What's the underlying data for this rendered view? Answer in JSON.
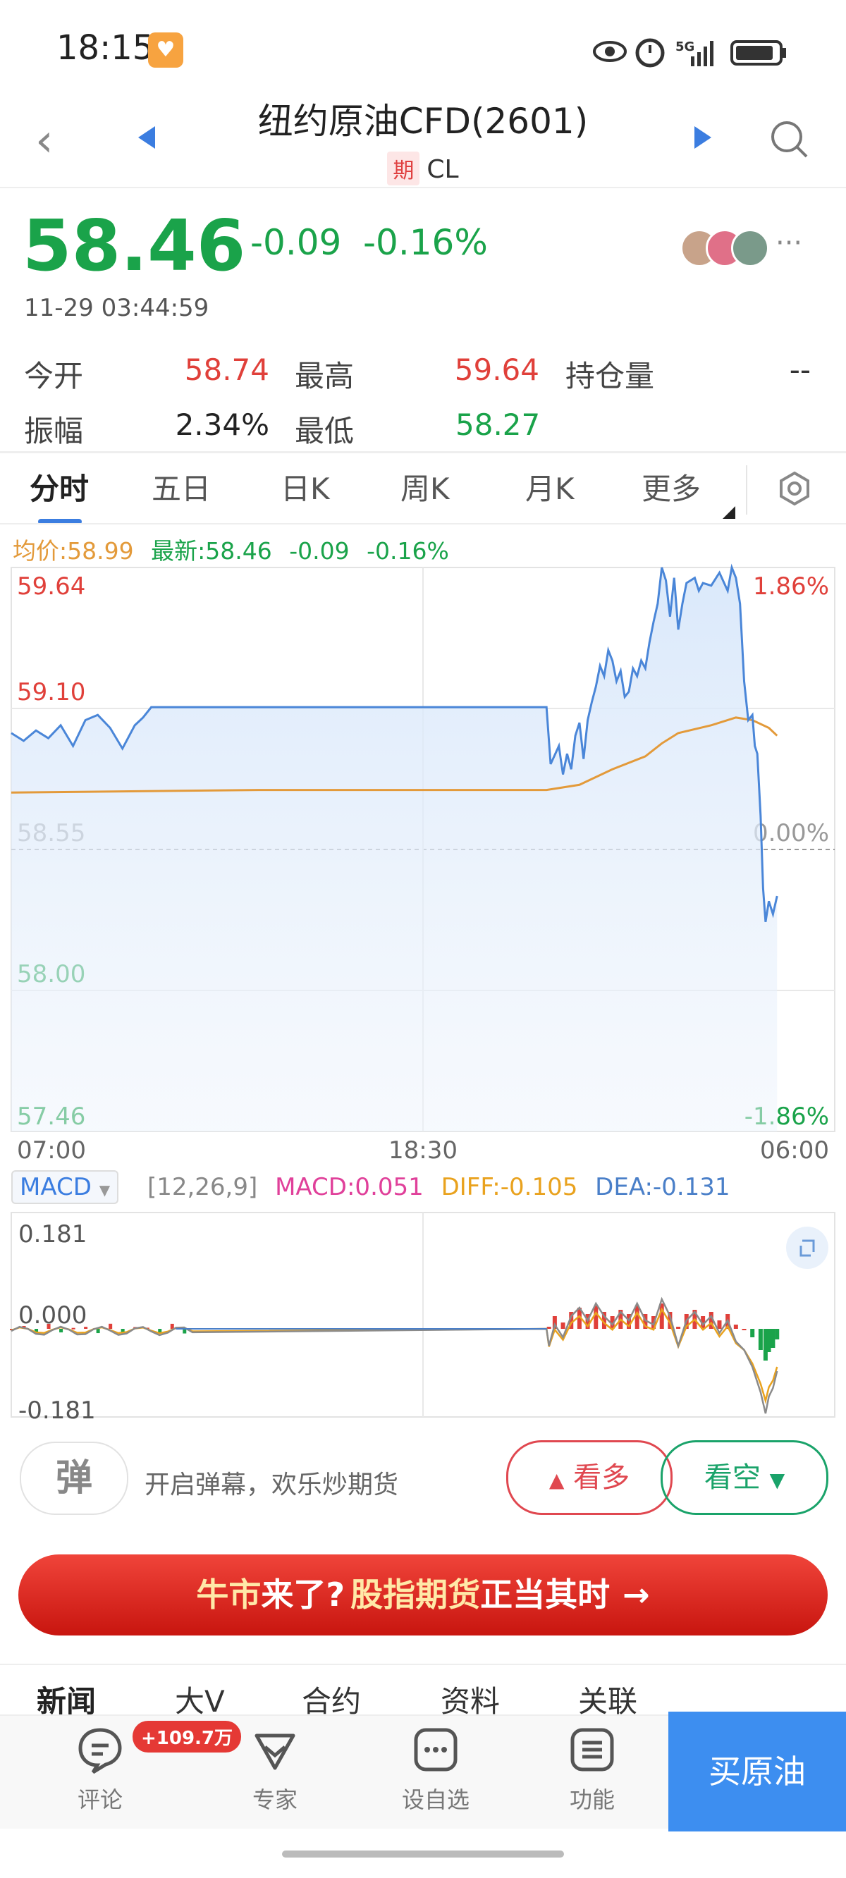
{
  "status_bar": {
    "time": "18:15",
    "network": "5G"
  },
  "header": {
    "title": "纽约原油CFD(2601)",
    "tag": "期",
    "code": "CL"
  },
  "quote": {
    "price": "58.46",
    "change": "-0.09",
    "change_pct": "-0.16%",
    "timestamp": "11-29 03:44:59",
    "stats": [
      {
        "label": "今开",
        "value": "58.74",
        "color": "#e0403a"
      },
      {
        "label": "最高",
        "value": "59.64",
        "color": "#e0403a"
      },
      {
        "label": "持仓量",
        "value": "--",
        "color": "#333333"
      },
      {
        "label": "振幅",
        "value": "2.34%",
        "color": "#222222"
      },
      {
        "label": "最低",
        "value": "58.27",
        "color": "#1aa34a"
      }
    ]
  },
  "tabs": [
    "分时",
    "五日",
    "日K",
    "周K",
    "月K",
    "更多"
  ],
  "chart_header": {
    "avg": "均价:58.99",
    "latest": "最新:58.46",
    "change": "-0.09",
    "change_pct": "-0.16%"
  },
  "chart_data": {
    "type": "line",
    "series": [],
    "x_ticks": [
      "07:00",
      "18:30",
      "06:00"
    ],
    "y_ticks_left": [
      "59.64",
      "59.10",
      "58.55",
      "58.00",
      "57.46"
    ],
    "y_ticks_right": [
      "1.86%",
      "",
      "0.00%",
      "",
      "-1.86%"
    ],
    "ylim": [
      57.46,
      59.64
    ],
    "baseline": 58.55,
    "price": [
      [
        0,
        59.0
      ],
      [
        1.5,
        58.97
      ],
      [
        3,
        59.01
      ],
      [
        4.5,
        58.98
      ],
      [
        6,
        59.03
      ],
      [
        7.5,
        58.95
      ],
      [
        9,
        59.05
      ],
      [
        10.5,
        59.07
      ],
      [
        12,
        59.02
      ],
      [
        13.5,
        58.94
      ],
      [
        15,
        59.03
      ],
      [
        16,
        59.06
      ],
      [
        17,
        59.1
      ],
      [
        30,
        59.1
      ],
      [
        45,
        59.1
      ],
      [
        60,
        59.1
      ],
      [
        65,
        59.1
      ],
      [
        65.5,
        58.88
      ],
      [
        66.5,
        58.95
      ],
      [
        67,
        58.84
      ],
      [
        67.5,
        58.92
      ],
      [
        68,
        58.86
      ],
      [
        68.5,
        58.99
      ],
      [
        69,
        59.04
      ],
      [
        69.5,
        58.9
      ],
      [
        70,
        59.05
      ],
      [
        70.5,
        59.12
      ],
      [
        71,
        59.18
      ],
      [
        71.5,
        59.26
      ],
      [
        72,
        59.22
      ],
      [
        72.5,
        59.32
      ],
      [
        73,
        59.28
      ],
      [
        73.5,
        59.2
      ],
      [
        74,
        59.24
      ],
      [
        74.5,
        59.14
      ],
      [
        75,
        59.16
      ],
      [
        75.5,
        59.25
      ],
      [
        76,
        59.22
      ],
      [
        76.5,
        59.28
      ],
      [
        77,
        59.25
      ],
      [
        77.5,
        59.35
      ],
      [
        78,
        59.43
      ],
      [
        78.5,
        59.5
      ],
      [
        79,
        59.64
      ],
      [
        79.5,
        59.59
      ],
      [
        80,
        59.45
      ],
      [
        80.5,
        59.6
      ],
      [
        81,
        59.4
      ],
      [
        81.5,
        59.5
      ],
      [
        82,
        59.58
      ],
      [
        83,
        59.6
      ],
      [
        83.5,
        59.55
      ],
      [
        84,
        59.58
      ],
      [
        85,
        59.57
      ],
      [
        86,
        59.62
      ],
      [
        87,
        59.55
      ],
      [
        87.5,
        59.64
      ],
      [
        88,
        59.6
      ],
      [
        88.5,
        59.5
      ],
      [
        89,
        59.2
      ],
      [
        89.5,
        59.05
      ],
      [
        90,
        59.07
      ],
      [
        90.3,
        58.95
      ],
      [
        90.6,
        58.92
      ],
      [
        91,
        58.68
      ],
      [
        91.3,
        58.4
      ],
      [
        91.6,
        58.27
      ],
      [
        92,
        58.35
      ],
      [
        92.5,
        58.3
      ],
      [
        93,
        58.37
      ]
    ],
    "avg": [
      [
        0,
        58.77
      ],
      [
        30,
        58.78
      ],
      [
        65,
        58.78
      ],
      [
        69,
        58.8
      ],
      [
        73,
        58.86
      ],
      [
        77,
        58.91
      ],
      [
        79,
        58.96
      ],
      [
        81,
        59.0
      ],
      [
        85,
        59.03
      ],
      [
        88,
        59.06
      ],
      [
        90,
        59.05
      ],
      [
        92,
        59.02
      ],
      [
        93,
        58.99
      ]
    ],
    "x_max": 100,
    "macd_legend": {
      "dropdown": "MACD",
      "params": "[12,26,9]",
      "macd": "MACD:0.051",
      "diff": "DIFF:-0.105",
      "dea": "DEA:-0.131"
    },
    "macd_ticks": [
      "0.181",
      "0.000",
      "-0.181"
    ],
    "macd_colors": {
      "macd": "#e0409a",
      "diff": "#e9a21e",
      "dea": "#4a7fc8"
    }
  },
  "danmaku": {
    "icon_char": "弹",
    "prompt": "开启弹幕，欢乐炒期货",
    "bull": "看多",
    "bear": "看空"
  },
  "banner": {
    "part1": "牛市",
    "part2": "来了?",
    "part3": "股指期货",
    "part4": "正当其时"
  },
  "news_tabs": [
    "新闻",
    "大V",
    "合约",
    "资料",
    "关联"
  ],
  "bottom_nav": [
    {
      "label": "评论",
      "icon": "comment-icon"
    },
    {
      "label": "专家",
      "icon": "expert-icon"
    },
    {
      "label": "设自选",
      "icon": "watchlist-icon"
    },
    {
      "label": "功能",
      "icon": "function-icon"
    }
  ],
  "comment_badge": "+109.7万",
  "buy_label": "买原油",
  "colors": {
    "up": "#e0403a",
    "down": "#1aa34a",
    "accent": "#3b7de0",
    "price_line": "#4a86d8",
    "avg_line": "#e39a3a"
  }
}
